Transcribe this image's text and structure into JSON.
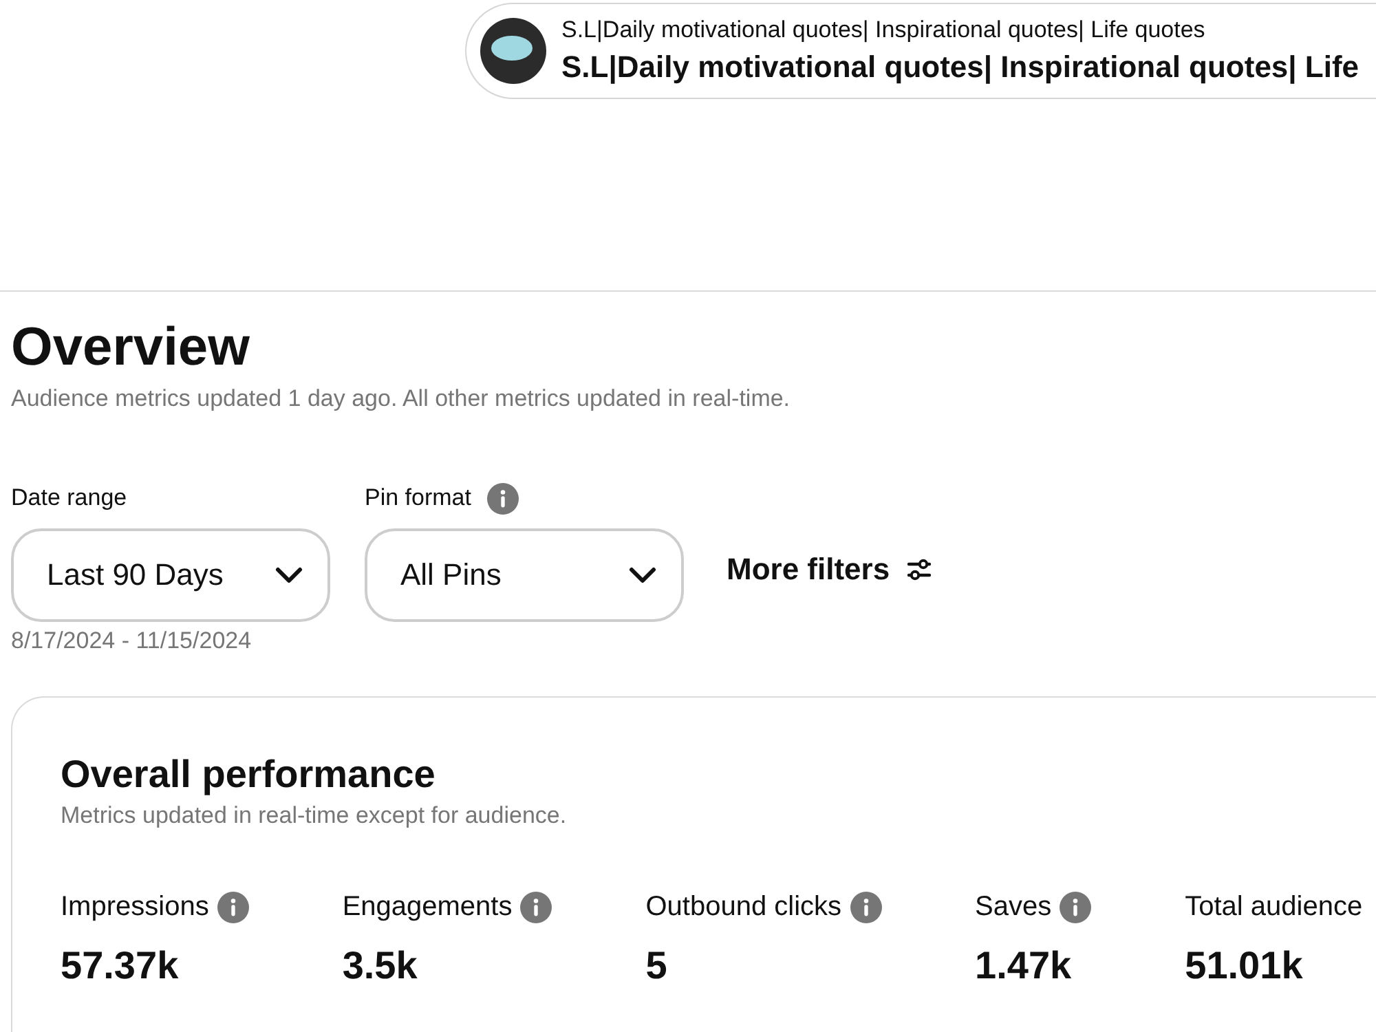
{
  "profile": {
    "subtitle": "S.L|Daily motivational quotes| Inspirational quotes| Life quotes",
    "name": "S.L|Daily motivational quotes| Inspirational quotes| Life"
  },
  "overview": {
    "title": "Overview",
    "note": "Audience metrics updated 1 day ago. All other metrics updated in real-time."
  },
  "filters": [
    {
      "label": "Date range",
      "info": false,
      "value": "Last 90 Days",
      "hint": "8/17/2024 - 11/15/2024"
    },
    {
      "label": "Pin format",
      "info": true,
      "value": "All Pins"
    }
  ],
  "more_filters": {
    "label": "More filters"
  },
  "performance": {
    "title": "Overall performance",
    "note": "Metrics updated in real-time except for audience.",
    "metrics": [
      {
        "label": "Impressions",
        "info": true,
        "value": "57.37k"
      },
      {
        "label": "Engagements",
        "info": true,
        "value": "3.5k"
      },
      {
        "label": "Outbound clicks",
        "info": true,
        "value": "5"
      },
      {
        "label": "Saves",
        "info": true,
        "value": "1.47k"
      },
      {
        "label": "Total audience",
        "info": false,
        "value": "51.01k"
      }
    ]
  }
}
